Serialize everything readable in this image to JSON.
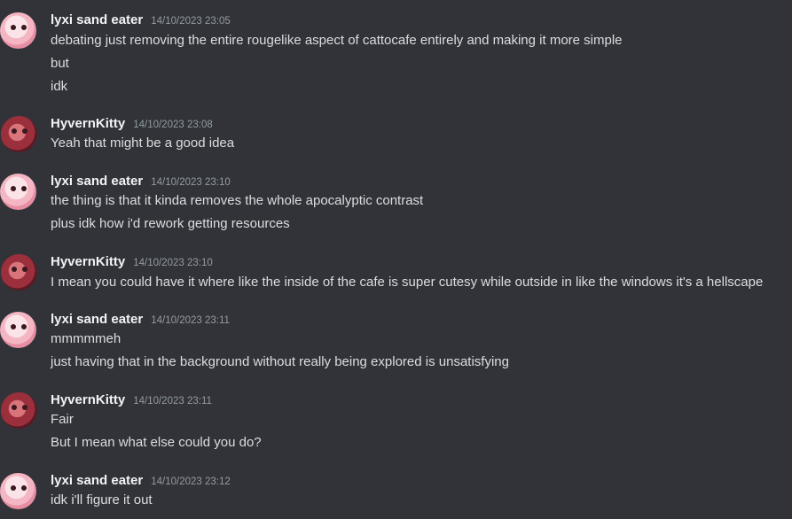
{
  "messages": [
    {
      "author": "lyxi sand eater",
      "timestamp": "14/10/2023 23:05",
      "avatar_icon": "lyxi-avatar",
      "lines": [
        "debating just removing the entire rougelike aspect of cattocafe entirely and making it more simple",
        "but",
        "idk"
      ]
    },
    {
      "author": "HyvernKitty",
      "timestamp": "14/10/2023 23:08",
      "avatar_icon": "hyvernkitty-avatar",
      "lines": [
        "Yeah that might be a good idea"
      ]
    },
    {
      "author": "lyxi sand eater",
      "timestamp": "14/10/2023 23:10",
      "avatar_icon": "lyxi-avatar",
      "lines": [
        "the thing is that it kinda removes the whole apocalyptic contrast",
        "plus idk how i'd rework getting resources"
      ]
    },
    {
      "author": "HyvernKitty",
      "timestamp": "14/10/2023 23:10",
      "avatar_icon": "hyvernkitty-avatar",
      "lines": [
        "I mean you could have it where like the inside of the cafe is super cutesy while outside in like the windows it's a hellscape"
      ]
    },
    {
      "author": "lyxi sand eater",
      "timestamp": "14/10/2023 23:11",
      "avatar_icon": "lyxi-avatar",
      "lines": [
        "mmmmmeh",
        "just having that in the background without really being explored is unsatisfying"
      ]
    },
    {
      "author": "HyvernKitty",
      "timestamp": "14/10/2023 23:11",
      "avatar_icon": "hyvernkitty-avatar",
      "lines": [
        "Fair",
        "But I mean what else could you do?"
      ]
    },
    {
      "author": "lyxi sand eater",
      "timestamp": "14/10/2023 23:12",
      "avatar_icon": "lyxi-avatar",
      "lines": [
        "idk i'll figure it out"
      ]
    }
  ],
  "colors": {
    "background": "#313338",
    "text": "#dbdee1",
    "author": "#f2f3f5",
    "timestamp": "#949ba4"
  }
}
